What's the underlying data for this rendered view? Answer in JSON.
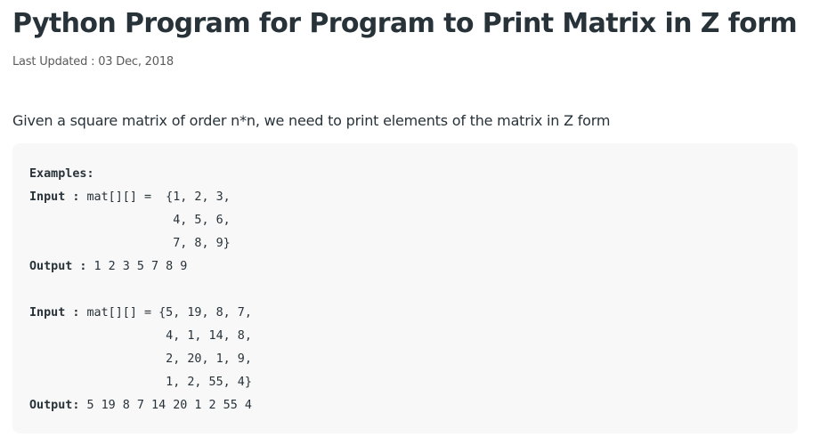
{
  "article": {
    "title": "Python Program for Program to Print Matrix in Z form",
    "last_updated": "Last Updated : 03 Dec, 2018",
    "description": "Given a square matrix of order n*n, we need to print elements of the matrix in Z form"
  },
  "code_block": {
    "lines": [
      {
        "bold": "Examples:",
        "rest": ""
      },
      {
        "bold": "Input :",
        "rest": " mat[][] =  {1, 2, 3,"
      },
      {
        "bold": "",
        "rest": "                    4, 5, 6,"
      },
      {
        "bold": "",
        "rest": "                    7, 8, 9}"
      },
      {
        "bold": "Output :",
        "rest": " 1 2 3 5 7 8 9"
      },
      {
        "bold": "",
        "rest": ""
      },
      {
        "bold": "Input :",
        "rest": " mat[][] = {5, 19, 8, 7,"
      },
      {
        "bold": "",
        "rest": "                   4, 1, 14, 8,"
      },
      {
        "bold": "",
        "rest": "                   2, 20, 1, 9,"
      },
      {
        "bold": "",
        "rest": "                   1, 2, 55, 4}"
      },
      {
        "bold": "Output:",
        "rest": " 5 19 8 7 14 20 1 2 55 4"
      }
    ]
  }
}
